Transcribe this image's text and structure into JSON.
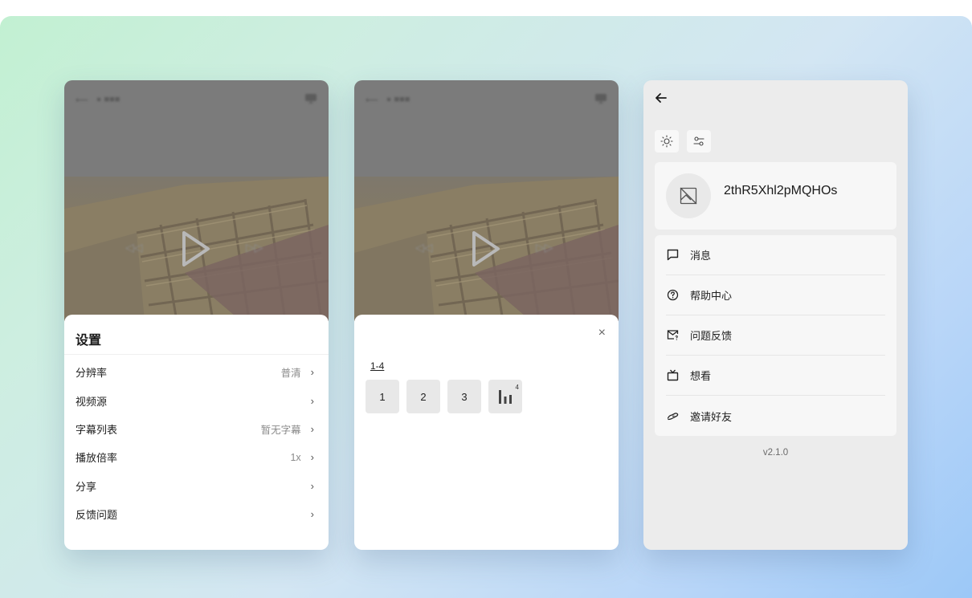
{
  "settings_panel": {
    "title": "设置",
    "items": [
      {
        "label": "分辨率",
        "value": "普清"
      },
      {
        "label": "视频源",
        "value": ""
      },
      {
        "label": "字幕列表",
        "value": "暂无字幕"
      },
      {
        "label": "播放倍率",
        "value": "1x"
      },
      {
        "label": "分享",
        "value": ""
      },
      {
        "label": "反馈问题",
        "value": ""
      }
    ],
    "chevron": "›"
  },
  "episode_panel": {
    "range_tab": "1-4",
    "episodes": [
      "1",
      "2",
      "3"
    ],
    "playing_badge": "4",
    "close_glyph": "×"
  },
  "profile_panel": {
    "username": "2thR5Xhl2pMQHOs",
    "menu": [
      {
        "label": "消息",
        "icon": "message-icon"
      },
      {
        "label": "帮助中心",
        "icon": "help-icon"
      },
      {
        "label": "问题反馈",
        "icon": "feedback-icon"
      },
      {
        "label": "想看",
        "icon": "tv-icon"
      },
      {
        "label": "邀请好友",
        "icon": "invite-icon"
      }
    ],
    "version": "v2.1.0"
  },
  "colors": {
    "background_gradient_start": "#c2f0d2",
    "background_gradient_end": "#9cc8f7",
    "overlay": "#7b7b7b",
    "sheet": "#ffffff",
    "episode_button": "#e8e8e8",
    "profile_bg": "#ececec"
  }
}
